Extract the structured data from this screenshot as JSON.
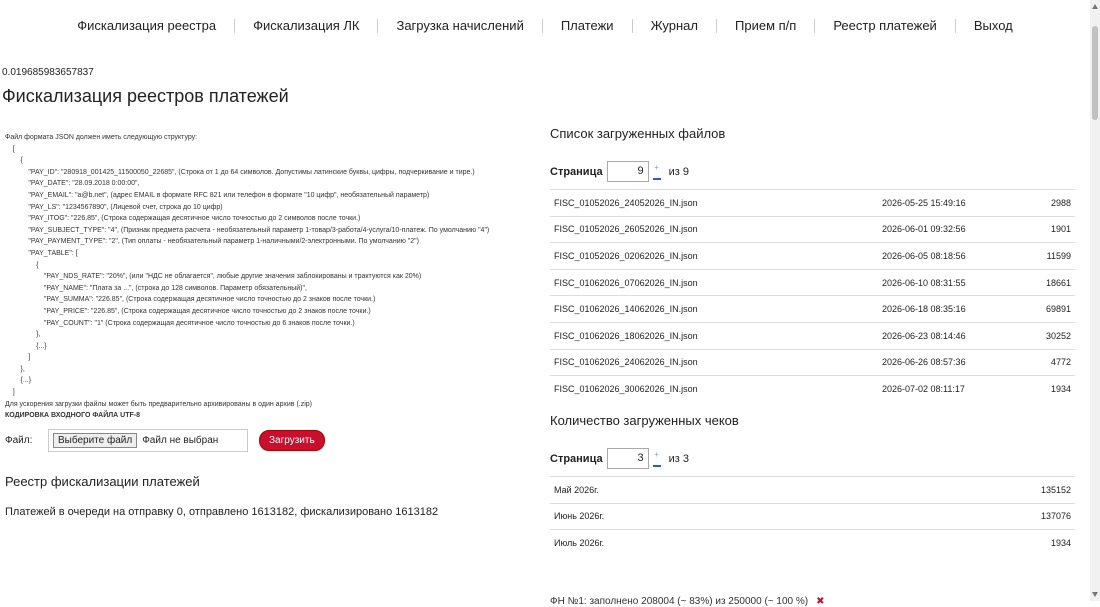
{
  "nav": [
    "Фискализация реестра",
    "Фискализация ЛК",
    "Загрузка начислений",
    "Платежи",
    "Журнал",
    "Прием п/п",
    "Реестр платежей",
    "Выход"
  ],
  "timing": "0.019685983657837",
  "page_title": "Фискализация реестров платежей",
  "json_doc": {
    "lines": [
      "Файл формата JSON должен иметь следующую структуру:",
      "    [",
      "        {",
      "            \"PAY_ID\": \"280918_001425_11500050_22685\", (Строка от 1 до 64 символов. Допустимы латинские буквы, цифры, подчеркивание и тире.)",
      "            \"PAY_DATE\": \"28.09.2018 0:00:00\",",
      "            \"PAY_EMAIL\": \"a@b.net\", (адрес EMAIL в формате RFC 821 или телефон в формате \"10 цифр\", необязательный параметр)",
      "            \"PAY_LS\": \"1234567890\", (Лицевой счет, строка до 10 цифр)",
      "            \"PAY_ITOG\": \"226.85\", (Строка содержащая десятичное число точностью до 2 символов после точки.)",
      "            \"PAY_SUBJECT_TYPE\": \"4\", (Признак предмета расчета - необязательный параметр 1-товар/3-работа/4-услуга/10-платеж. По умолчанию \"4\")",
      "            \"PAY_PAYMENT_TYPE\": \"2\", (Тип оплаты - необязательный параметр 1-наличными/2-электронными. По умолчанию \"2\")",
      "            \"PAY_TABLE\": [",
      "                {",
      "                    \"PAY_NDS_RATE\": \"20%\", (или \"НДС не облагается\", любые другие значения заблокированы и трактуются как 20%)",
      "                    \"PAY_NAME\": \"Плата за ...\", (строка до 128 символов. Параметр обязательный)\",",
      "                    \"PAY_SUMMA\": \"226.85\", (Строка содержащая десятичное число точностью до 2 знаков после точки.)",
      "                    \"PAY_PRICE\": \"226.85\", (Строка содержащая десятичное число точностью до 2 знаков после точки.)",
      "                    \"PAY_COUNT\": \"1\" (Строка содержащая десятичное число точностью до 6 знаков после точки.)",
      "                },",
      "                {...}",
      "            ]",
      "        },",
      "        {...}",
      "    ]",
      "Для ускорения загрузки файлы может быть предварительно архивированы в один архив (.zip)"
    ],
    "encoding_note": "КОДИРОВКА ВХОДНОГО ФАЙЛА UTF-8"
  },
  "upload": {
    "label": "Файл:",
    "choose_label": "Выберите файл",
    "no_file": "Файл не выбран",
    "submit_label": "Загрузить"
  },
  "registry_title": "Реестр фискализации платежей",
  "queue_status": "Платежей в очереди на отправку 0, отправлено 1613182, фискализировано 1613182",
  "files_section": {
    "title": "Список загруженных файлов",
    "pager_label": "Страница",
    "page": "9",
    "of_label": "из 9",
    "rows": [
      {
        "name": "FISC_01052026_24052026_IN.json",
        "date": "2026-05-25 15:49:16",
        "count": "2988"
      },
      {
        "name": "FISC_01052026_26052026_IN.json",
        "date": "2026-06-01 09:32:56",
        "count": "1901"
      },
      {
        "name": "FISC_01052026_02062026_IN.json",
        "date": "2026-06-05 08:18:56",
        "count": "11599"
      },
      {
        "name": "FISC_01062026_07062026_IN.json",
        "date": "2026-06-10 08:31:55",
        "count": "18661"
      },
      {
        "name": "FISC_01062026_14062026_IN.json",
        "date": "2026-06-18 08:35:16",
        "count": "69891"
      },
      {
        "name": "FISC_01062026_18062026_IN.json",
        "date": "2026-06-23 08:14:46",
        "count": "30252"
      },
      {
        "name": "FISC_01062026_24062026_IN.json",
        "date": "2026-06-26 08:57:36",
        "count": "4772"
      },
      {
        "name": "FISC_01062026_30062026_IN.json",
        "date": "2026-07-02 08:11:17",
        "count": "1934"
      }
    ]
  },
  "checks_section": {
    "title": "Количество загруженных чеков",
    "pager_label": "Страница",
    "page": "3",
    "of_label": "из 3",
    "rows": [
      {
        "month": "Май 2026г.",
        "count": "135152"
      },
      {
        "month": "Июнь 2026г.",
        "count": "137076"
      },
      {
        "month": "Июль 2026г.",
        "count": "1934"
      }
    ]
  },
  "cut_line": {
    "text": "ФН №1: заполнено 208004 (~ 83%) из 250000 (~ 100 %)",
    "icon": "close-icon"
  }
}
